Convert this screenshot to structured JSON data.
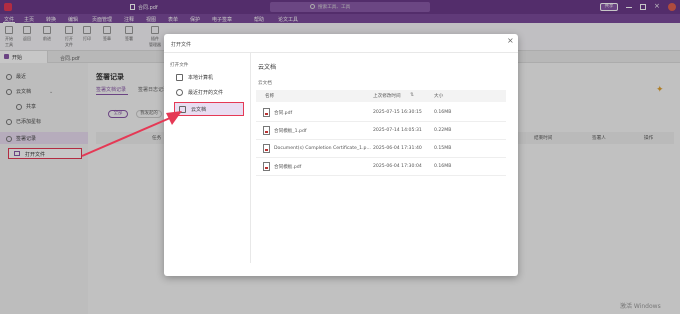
{
  "colors": {
    "brand": "#6b3a8a",
    "accent": "#8a58a8",
    "highlight": "#e53955",
    "selected_bg": "#e9ddf1"
  },
  "app": {
    "filename": "合同.pdf",
    "share": "共享",
    "search_placeholder": "搜索工具、工具"
  },
  "menu": [
    "文件",
    "主页",
    "转换",
    "编辑",
    "页面管理",
    "注释",
    "视图",
    "表单",
    "保护",
    "电子签章",
    "帮助",
    "论文工具"
  ],
  "ribbon": [
    {
      "label": "开始\n工具",
      "icon": "home-icon"
    },
    {
      "label": "返回",
      "icon": "back-icon"
    },
    {
      "label": "前进",
      "icon": "forward-icon"
    },
    {
      "label": "打开\n文件",
      "icon": "open-file-icon"
    },
    {
      "label": "打印",
      "icon": "print-icon"
    },
    {
      "label": "签章",
      "icon": "stamp-icon"
    },
    {
      "label": "签署",
      "icon": "sign-icon"
    },
    {
      "label": "插件\n管理器",
      "icon": "plugin-icon"
    }
  ],
  "tabs": {
    "home": "开始",
    "doc": "合同.pdf"
  },
  "sidebar": {
    "items": [
      {
        "label": "最近",
        "icon": "clock-icon"
      },
      {
        "label": "云文档",
        "icon": "cloud-icon"
      },
      {
        "label": "共享",
        "icon": "share-icon"
      },
      {
        "label": "已添加星标",
        "icon": "star-icon"
      },
      {
        "label": "签署记录",
        "icon": "record-icon"
      }
    ],
    "open_file": "打开文件"
  },
  "background": {
    "title": "签署记录",
    "subtabs": [
      "签署文档记录",
      "签署日志记录"
    ],
    "filters": [
      "全部",
      "我发起的"
    ],
    "columns": [
      "任务",
      "结束时间",
      "签署人",
      "操作"
    ]
  },
  "dialog": {
    "title": "打开文件",
    "nav_heading": "打开文件",
    "nav": [
      {
        "label": "本地计算机",
        "icon": "computer-icon"
      },
      {
        "label": "最近打开的文件",
        "icon": "clock-icon"
      },
      {
        "label": "云文档",
        "icon": "cloud-icon"
      }
    ],
    "heading": "云文档",
    "breadcrumb": "云文档",
    "columns": {
      "name": "名称",
      "modified": "上次修改时间",
      "size": "大小"
    },
    "files": [
      {
        "name": "合同.pdf",
        "modified": "2025-07-15 16:30:15",
        "size": "0.16MB"
      },
      {
        "name": "合同模板_1.pdf",
        "modified": "2025-07-14 14:05:31",
        "size": "0.22MB"
      },
      {
        "name": "Document(s) Completion Certificate_1.p...",
        "modified": "2025-06-04 17:31:40",
        "size": "0.15MB"
      },
      {
        "name": "合同模板.pdf",
        "modified": "2025-06-04 17:30:04",
        "size": "0.16MB"
      }
    ]
  },
  "watermark": "激活 Windows"
}
